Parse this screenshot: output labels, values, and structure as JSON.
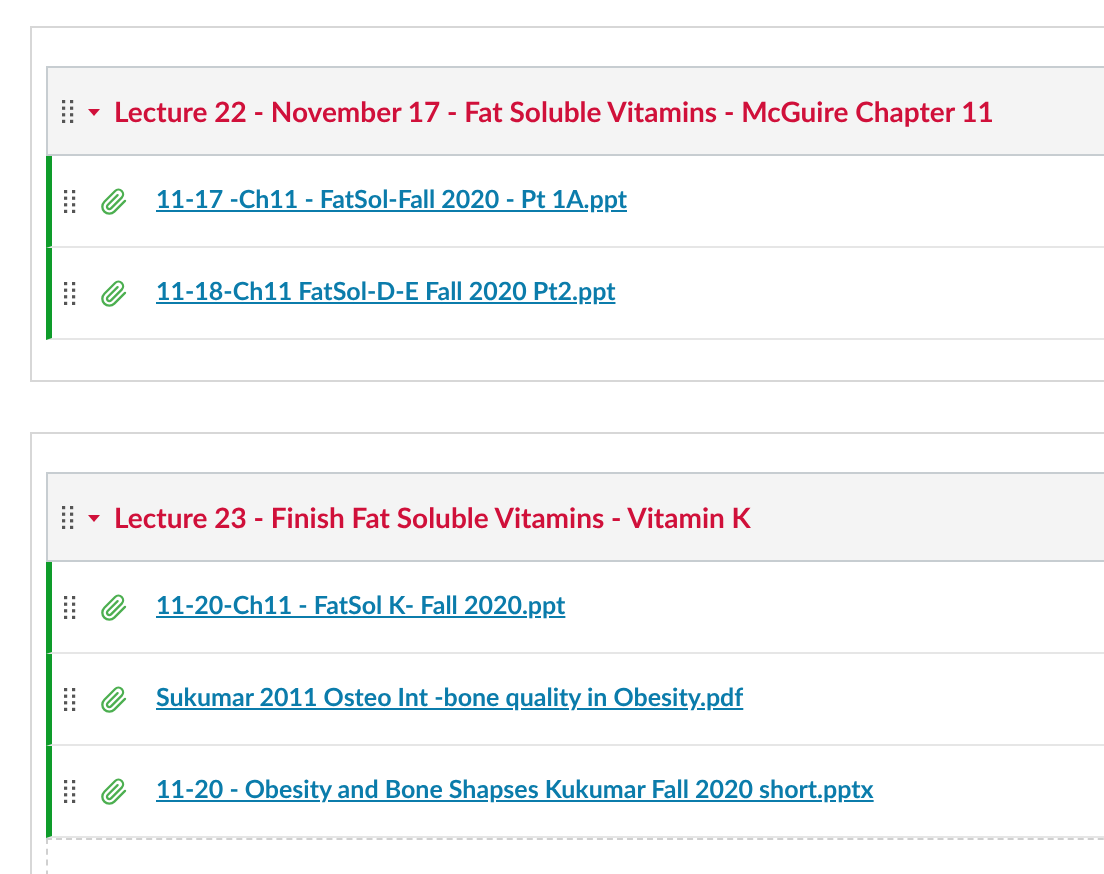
{
  "modules": [
    {
      "title": "Lecture 22 - November 17 - Fat Soluble Vitamins - McGuire Chapter 11",
      "expanded": true,
      "items": [
        {
          "title": "11-17 -Ch11 - FatSol-Fall 2020 - Pt 1A.ppt"
        },
        {
          "title": "11-18-Ch11 FatSol-D-E Fall 2020 Pt2.ppt"
        }
      ]
    },
    {
      "title": "Lecture 23 - Finish Fat Soluble Vitamins - Vitamin K",
      "expanded": true,
      "items": [
        {
          "title": "11-20-Ch11 - FatSol K- Fall 2020.ppt"
        },
        {
          "title": "Sukumar 2011 Osteo Int -bone quality in Obesity.pdf"
        },
        {
          "title": "11-20 - Obesity and Bone Shapses Kukumar Fall 2020 short.pptx"
        }
      ]
    }
  ]
}
